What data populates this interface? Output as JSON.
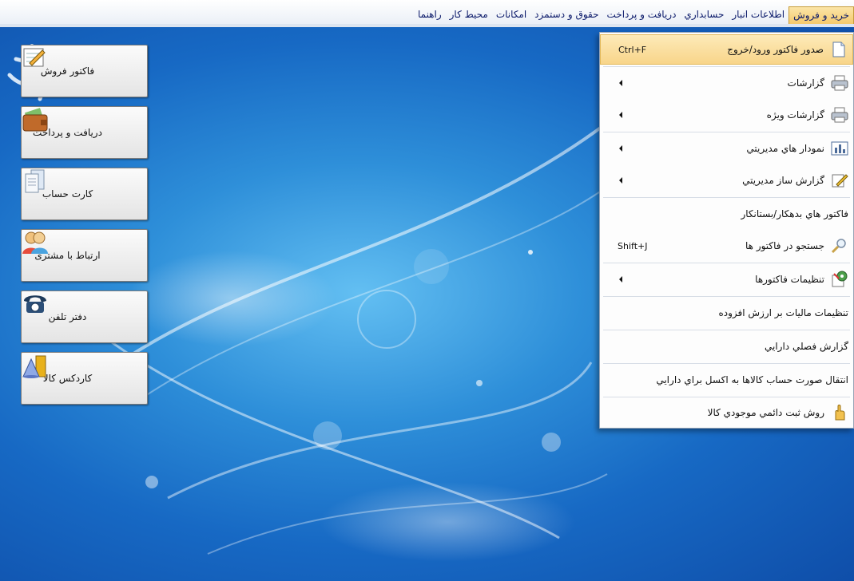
{
  "menubar": {
    "items": [
      {
        "label": "خريد و فروش",
        "active": true
      },
      {
        "label": "اطلاعات انبار"
      },
      {
        "label": "حسابداري"
      },
      {
        "label": "دريافت و پرداخت"
      },
      {
        "label": "حقوق و دستمزد"
      },
      {
        "label": "امكانات"
      },
      {
        "label": "محيط كار"
      },
      {
        "label": "راهنما"
      }
    ]
  },
  "shortcuts": [
    {
      "label": "فاکتور فروش",
      "icon": "invoice-pencil-icon"
    },
    {
      "label": "دریافت و پرداخت",
      "icon": "wallet-icon"
    },
    {
      "label": "کارت حساب",
      "icon": "account-card-icon"
    },
    {
      "label": "ارتباط با مشتری",
      "icon": "customers-icon"
    },
    {
      "label": "دفتر تلفن",
      "icon": "telephone-icon"
    },
    {
      "label": "کاردکس کالا",
      "icon": "goods-cardex-icon"
    }
  ],
  "dropdown": {
    "items": [
      {
        "label": "صدور فاكتور ورود/خروج",
        "shortcut": "Ctrl+F",
        "icon": "document-icon",
        "highlight": true
      },
      {
        "label": "گزارشات",
        "submenu": true,
        "icon": "printer-icon"
      },
      {
        "label": "گزارشات ويژه",
        "submenu": true,
        "icon": "printer-icon"
      },
      {
        "label": "نمودار هاي مديريتي",
        "submenu": true,
        "icon": "bar-chart-icon"
      },
      {
        "label": "گزارش ساز مديريتي",
        "submenu": true,
        "icon": "edit-report-icon"
      },
      {
        "label": "فاكتور هاي بدهكار/بستانكار"
      },
      {
        "label": "جستجو در فاكتور ها",
        "shortcut": "Shift+J",
        "icon": "magnifier-icon"
      },
      {
        "label": "تنظيمات فاكتورها",
        "submenu": true,
        "icon": "settings-icon"
      },
      {
        "label": "تنظيمات ماليات بر ارزش افزوده"
      },
      {
        "label": "گزارش فصلي دارايي"
      },
      {
        "label": "انتقال صورت حساب كالاها به اكسل براي دارايي"
      },
      {
        "label": "روش ثبت دائمي موجودي كالا",
        "icon": "hand-icon"
      }
    ]
  },
  "colors": {
    "accent": "#f8d58a",
    "desktop": "#1769c4"
  }
}
